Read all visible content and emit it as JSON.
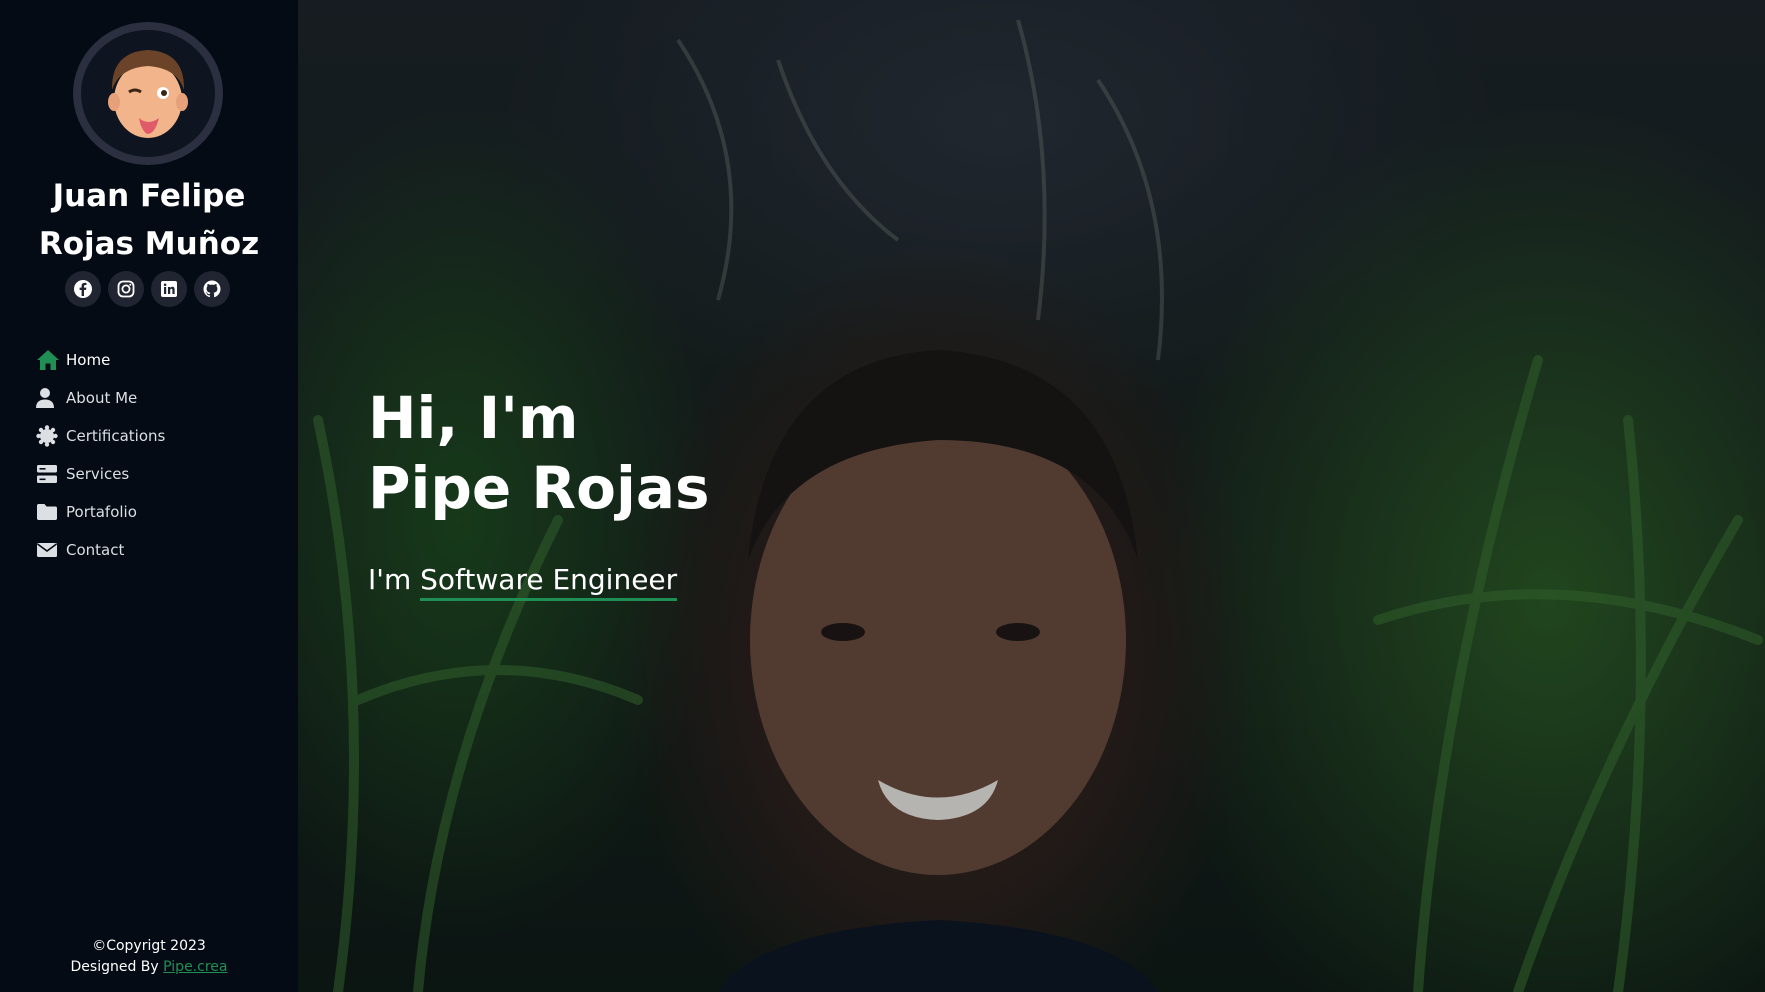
{
  "profile": {
    "name_line1": "Juan Felipe",
    "name_line2": "Rojas Muñoz"
  },
  "socials": [
    {
      "icon": "facebook-icon"
    },
    {
      "icon": "instagram-icon"
    },
    {
      "icon": "linkedin-icon"
    },
    {
      "icon": "github-icon"
    }
  ],
  "nav": {
    "items": [
      {
        "label": "Home",
        "icon": "home-icon",
        "active": true
      },
      {
        "label": "About Me",
        "icon": "user-icon"
      },
      {
        "label": "Certifications",
        "icon": "certificate-icon"
      },
      {
        "label": "Services",
        "icon": "server-icon"
      },
      {
        "label": "Portafolio",
        "icon": "folder-icon"
      },
      {
        "label": "Contact",
        "icon": "envelope-icon"
      }
    ]
  },
  "hero": {
    "title_line1": "Hi, I'm",
    "title_line2": "Pipe Rojas",
    "subtitle_prefix": "I'm ",
    "role": "Software Engineer"
  },
  "footer": {
    "copyright": "©Copyrigt 2023",
    "designed_by_prefix": "Designed By ",
    "designer_link": "Pipe.crea"
  },
  "colors": {
    "sidebar_bg": "#040b14",
    "accent": "#1f8f55",
    "social_bg": "#212431"
  }
}
